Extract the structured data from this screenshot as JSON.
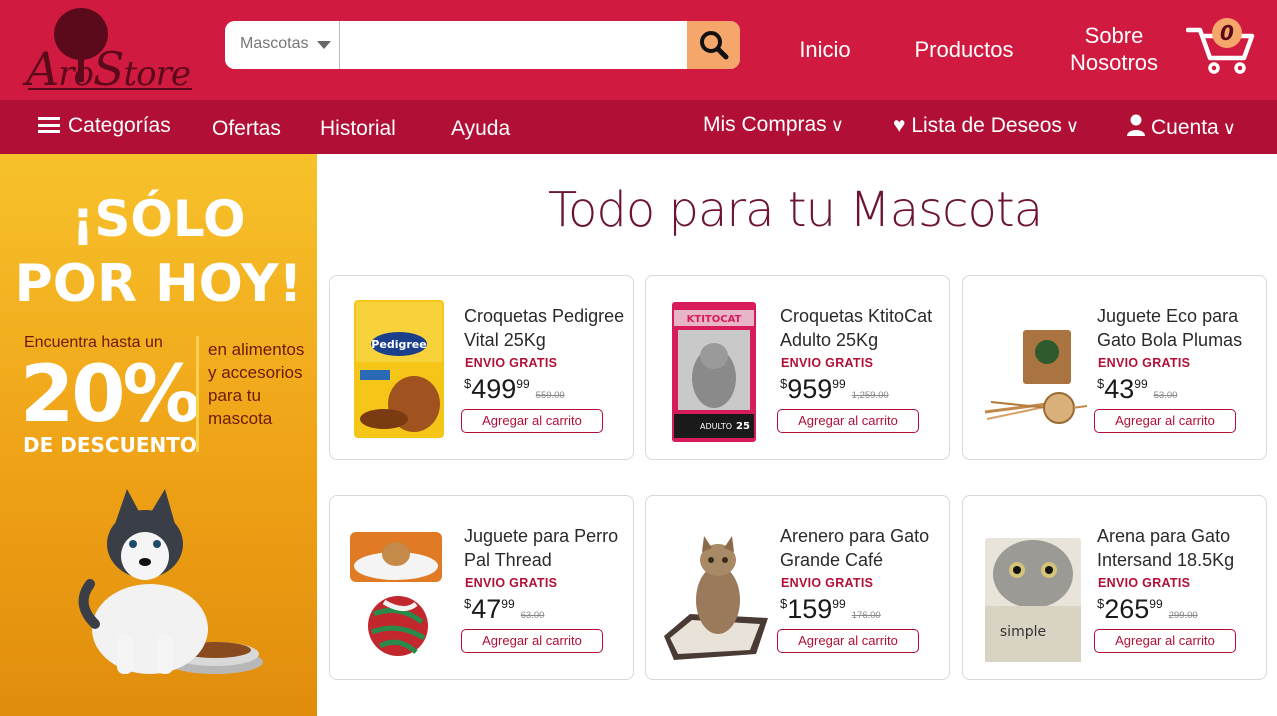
{
  "header": {
    "logo_text_1": "A",
    "logo_text_2": "ro",
    "logo_text_3": "S",
    "logo_text_4": "tore",
    "search": {
      "category": "Mascotas",
      "placeholder": "",
      "value": ""
    },
    "nav": {
      "inicio": "Inicio",
      "productos": "Productos",
      "sobre_1": "Sobre",
      "sobre_2": "Nosotros"
    },
    "cart_count": "0"
  },
  "subnav": {
    "categorias": "Categorías",
    "ofertas": "Ofertas",
    "historial": "Historial",
    "ayuda": "Ayuda",
    "mis_compras": "Mis Compras",
    "lista_deseos": "Lista de Deseos",
    "cuenta": "Cuenta"
  },
  "promo": {
    "line1": "¡SÓLO",
    "line2": "POR HOY!",
    "find": "Encuentra hasta un",
    "percent": "20%",
    "discount": "DE DESCUENTO",
    "side": "en alimentos y accesorios para tu mascota"
  },
  "main": {
    "title": "Todo para tu Mascota",
    "products": [
      {
        "name": "Croquetas Pedigree Vital 25Kg",
        "shipping": "ENVIO GRATIS",
        "price_int": "499",
        "price_cents": "99",
        "old_price": "559.00",
        "button": "Agregar al carrito"
      },
      {
        "name": "Croquetas KtitoCat Adulto 25Kg",
        "shipping": "ENVIO GRATIS",
        "price_int": "959",
        "price_cents": "99",
        "old_price": "1,259.00",
        "button": "Agregar al carrito"
      },
      {
        "name": "Juguete Eco para Gato Bola Plumas",
        "shipping": "ENVIO GRATIS",
        "price_int": "43",
        "price_cents": "99",
        "old_price": "53.00",
        "button": "Agregar al carrito"
      },
      {
        "name": "Juguete para Perro Pal Thread",
        "shipping": "ENVIO GRATIS",
        "price_int": "47",
        "price_cents": "99",
        "old_price": "63.00",
        "button": "Agregar al carrito"
      },
      {
        "name": "Arenero para Gato Grande Café",
        "shipping": "ENVIO GRATIS",
        "price_int": "159",
        "price_cents": "99",
        "old_price": "176.00",
        "button": "Agregar al carrito"
      },
      {
        "name": "Arena para Gato Intersand 18.5Kg",
        "shipping": "ENVIO GRATIS",
        "price_int": "265",
        "price_cents": "99",
        "old_price": "299.00",
        "button": "Agregar al carrito"
      }
    ]
  },
  "colors": {
    "brand_red": "#d11a3f",
    "subnav_red": "#b20f36",
    "accent_orange": "#f5a66a",
    "promo_yellow": "#f7c22c"
  },
  "icons": {
    "search": "search-icon",
    "cart": "cart-icon",
    "menu": "hamburger-icon",
    "heart": "heart-icon",
    "user": "user-icon"
  }
}
